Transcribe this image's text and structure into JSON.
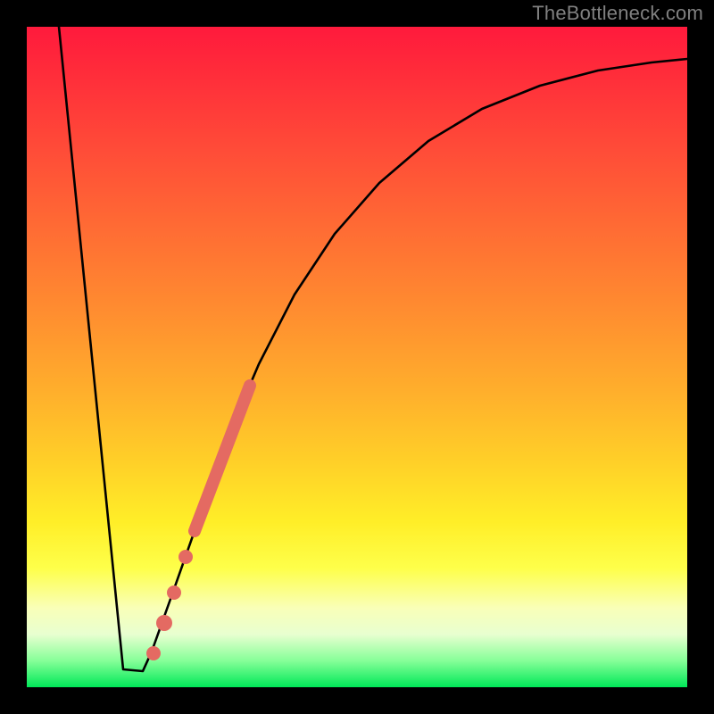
{
  "watermark": "TheBottleneck.com",
  "chart_data": {
    "type": "line",
    "title": "",
    "xlabel": "",
    "ylabel": "",
    "xlim": [
      0,
      100
    ],
    "ylim": [
      0,
      100
    ],
    "grid": false,
    "series": [
      {
        "name": "bottleneck-curve",
        "color": "#000000",
        "x": [
          0,
          2,
          4,
          6,
          8,
          10,
          12,
          14,
          15,
          16,
          18,
          20,
          22,
          25,
          28,
          32,
          36,
          40,
          45,
          50,
          55,
          60,
          65,
          70,
          75,
          80,
          85,
          90,
          95,
          100
        ],
        "y": [
          100,
          90,
          78,
          64,
          48,
          30,
          12,
          2,
          2,
          2,
          8,
          18,
          28,
          40,
          50,
          60,
          68,
          74,
          80,
          84,
          87,
          89,
          90.5,
          91.5,
          92.2,
          92.8,
          93.2,
          93.5,
          93.8,
          94
        ]
      },
      {
        "name": "highlight-segment",
        "color": "#e46a62",
        "style": "thick-dotted",
        "x": [
          16,
          18,
          20,
          22,
          24,
          26,
          28,
          30,
          32
        ],
        "y": [
          2,
          8,
          18,
          28,
          36,
          44,
          50,
          56,
          60
        ]
      }
    ]
  }
}
